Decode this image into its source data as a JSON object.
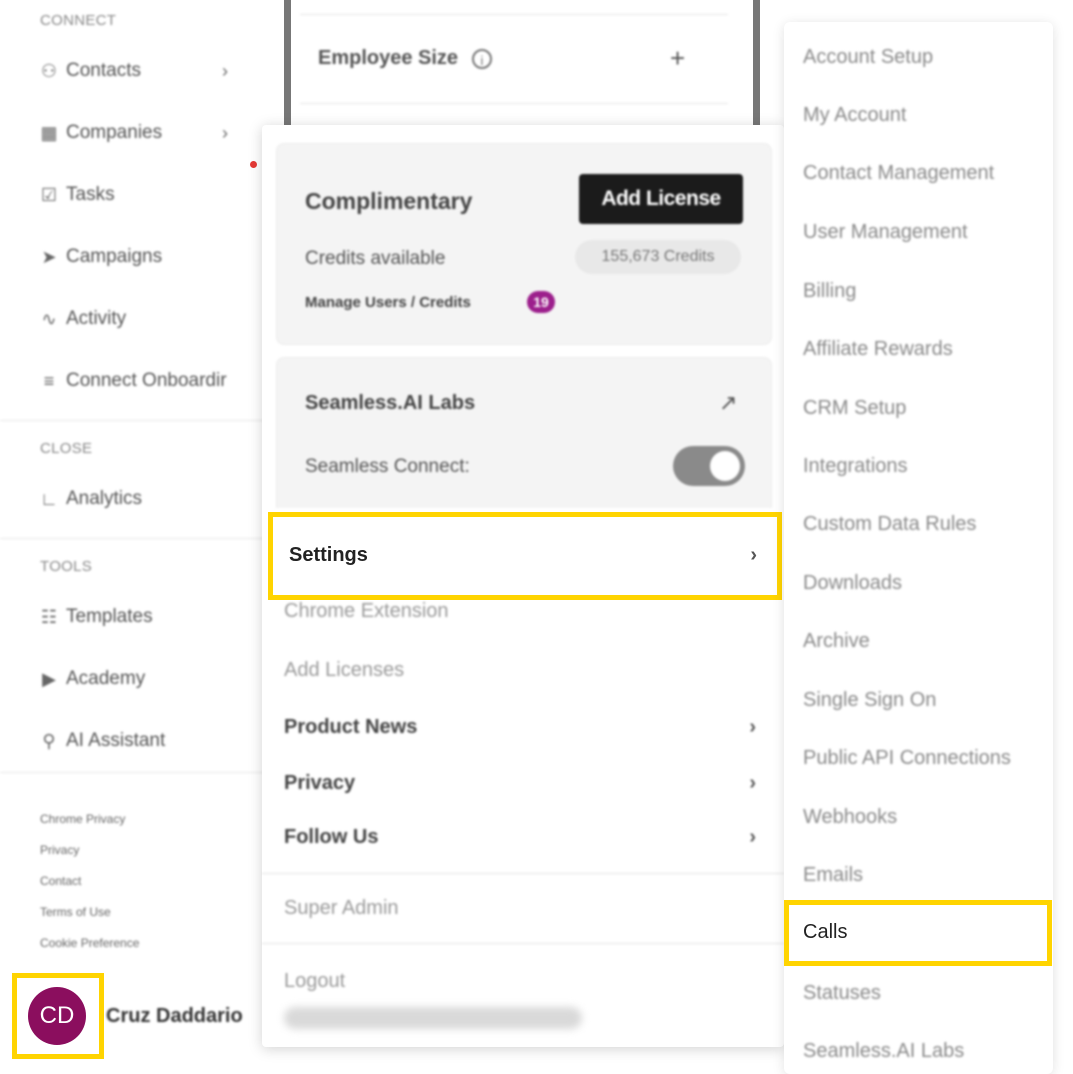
{
  "sidebar": {
    "sections": {
      "connect": "CONNECT",
      "close": "CLOSE",
      "tools": "TOOLS"
    },
    "connect_items": [
      {
        "label": "Contacts",
        "icon": "contacts-icon",
        "has_chevron": true
      },
      {
        "label": "Companies",
        "icon": "companies-icon",
        "has_chevron": true
      },
      {
        "label": "Tasks",
        "icon": "tasks-icon",
        "has_chevron": false
      },
      {
        "label": "Campaigns",
        "icon": "campaigns-icon",
        "has_chevron": false
      },
      {
        "label": "Activity",
        "icon": "activity-icon",
        "has_chevron": false
      },
      {
        "label": "Connect Onboardir",
        "icon": "list-icon",
        "has_chevron": false
      }
    ],
    "close_items": [
      {
        "label": "Analytics",
        "icon": "analytics-icon"
      }
    ],
    "tools_items": [
      {
        "label": "Templates",
        "icon": "templates-icon"
      },
      {
        "label": "Academy",
        "icon": "academy-icon"
      },
      {
        "label": "AI Assistant",
        "icon": "ai-assistant-icon"
      }
    ],
    "footer_links": [
      "Chrome Privacy",
      "Privacy",
      "Contact",
      "Terms of Use",
      "Cookie Preference"
    ],
    "user": {
      "initials": "CD",
      "name": "Cruz Daddario",
      "avatar_color": "#8b0e5e"
    }
  },
  "filter_panel": {
    "label": "Employee Size"
  },
  "menu": {
    "plan": {
      "name": "Complimentary",
      "add_license": "Add License",
      "credits_label": "Credits available",
      "credits_value": "155,673 Credits",
      "manage_label": "Manage Users / Credits",
      "manage_badge": "19"
    },
    "labs": {
      "title": "Seamless.AI Labs",
      "connect_label": "Seamless Connect:",
      "connect_on": true
    },
    "items": {
      "settings": "Settings",
      "chrome_extension": "Chrome Extension",
      "add_licenses": "Add Licenses",
      "product_news": "Product News",
      "privacy": "Privacy",
      "follow_us": "Follow Us",
      "super_admin": "Super Admin",
      "logout": "Logout"
    }
  },
  "settings_submenu": {
    "items": [
      "Account Setup",
      "My Account",
      "Contact Management",
      "User Management",
      "Billing",
      "Affiliate Rewards",
      "CRM Setup",
      "Integrations",
      "Custom Data Rules",
      "Downloads",
      "Archive",
      "Single Sign On",
      "Public API Connections",
      "Webhooks",
      "Emails"
    ],
    "highlighted": "Calls",
    "after": [
      "Statuses",
      "Seamless.AI Labs"
    ]
  },
  "colors": {
    "highlight": "#ffd400",
    "avatar": "#8b0e5e",
    "badge": "#9c1f8c",
    "notification_dot": "#e53935"
  }
}
